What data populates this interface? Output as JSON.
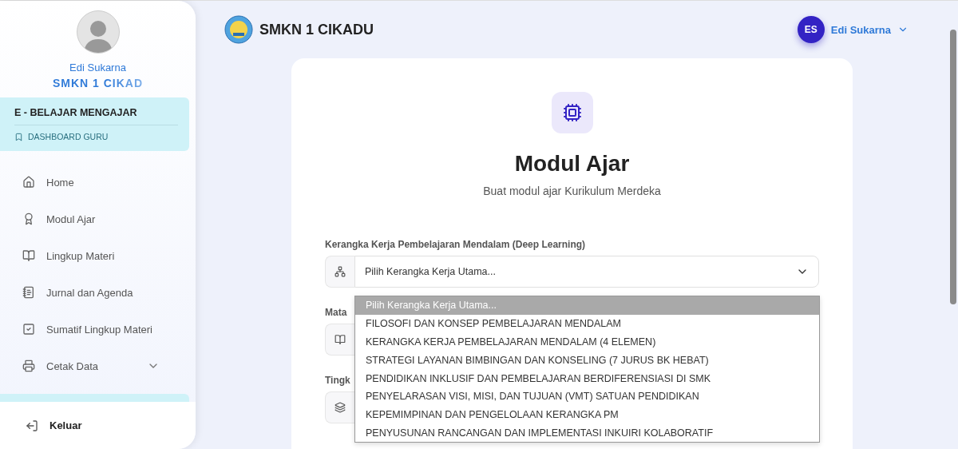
{
  "sidebar": {
    "user_name": "Edi Sukarna",
    "school": "SMKN 1 CIKAD",
    "section": {
      "title": "E - BELAJAR MENGAJAR",
      "link": "DASHBOARD GURU"
    },
    "items": [
      {
        "label": "Home",
        "kind": "home"
      },
      {
        "label": "Modul Ajar",
        "kind": "award"
      },
      {
        "label": "Lingkup Materi",
        "kind": "book"
      },
      {
        "label": "Jurnal dan Agenda",
        "kind": "notes"
      },
      {
        "label": "Sumatif Lingkup Materi",
        "kind": "check"
      },
      {
        "label": "Cetak Data",
        "kind": "printer",
        "expanded": false
      }
    ],
    "logout": "Keluar"
  },
  "header": {
    "school": "SMKN 1 CIKADU",
    "user_initials": "ES",
    "user_name": "Edi Sukarna"
  },
  "card": {
    "title": "Modul Ajar",
    "subtitle": "Buat modul ajar Kurikulum Merdeka",
    "fields": [
      {
        "label": "Kerangka Kerja Pembelajaran Mendalam (Deep Learning)",
        "kind": "sitemap",
        "value": "Pilih Kerangka Kerja Utama..."
      },
      {
        "label": "Mata",
        "kind": "book"
      },
      {
        "label": "Tingk",
        "kind": "layers"
      }
    ],
    "dropdown": [
      {
        "label": "Pilih Kerangka Kerja Utama...",
        "selected": true
      },
      {
        "label": "FILOSOFI DAN KONSEP PEMBELAJARAN MENDALAM",
        "selected": false
      },
      {
        "label": "KERANGKA KERJA PEMBELAJARAN MENDALAM (4 ELEMEN)",
        "selected": false
      },
      {
        "label": "STRATEGI LAYANAN BIMBINGAN DAN KONSELING (7 JURUS BK HEBAT)",
        "selected": false
      },
      {
        "label": "PENDIDIKAN INKLUSIF DAN PEMBELAJARAN BERDIFERENSIASI DI SMK",
        "selected": false
      },
      {
        "label": "PENYELARASAN VISI, MISI, DAN TUJUAN (VMT) SATUAN PENDIDIKAN",
        "selected": false
      },
      {
        "label": "KEPEMIMPINAN DAN PENGELOLAAN KERANGKA PM",
        "selected": false
      },
      {
        "label": "PENYUSUNAN RANCANGAN DAN IMPLEMENTASI INKUIRI KOLABORATIF",
        "selected": false
      }
    ]
  }
}
